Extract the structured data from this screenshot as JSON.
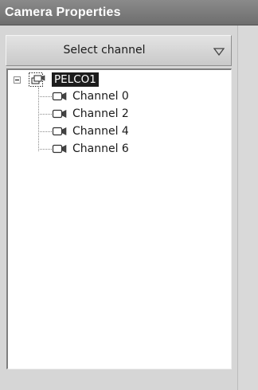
{
  "panel": {
    "title": "Camera Properties"
  },
  "dropdown": {
    "selected": "Select channel",
    "arrow_icon": "triangle-down-icon"
  },
  "tree": {
    "root": {
      "label": "PELCO1",
      "icon": "camera-group-icon",
      "expanded": true
    },
    "channels": [
      {
        "label": "Channel 0",
        "icon": "video-camera-icon"
      },
      {
        "label": "Channel 2",
        "icon": "video-camera-icon"
      },
      {
        "label": "Channel 4",
        "icon": "video-camera-icon"
      },
      {
        "label": "Channel 6",
        "icon": "video-camera-icon"
      }
    ]
  }
}
